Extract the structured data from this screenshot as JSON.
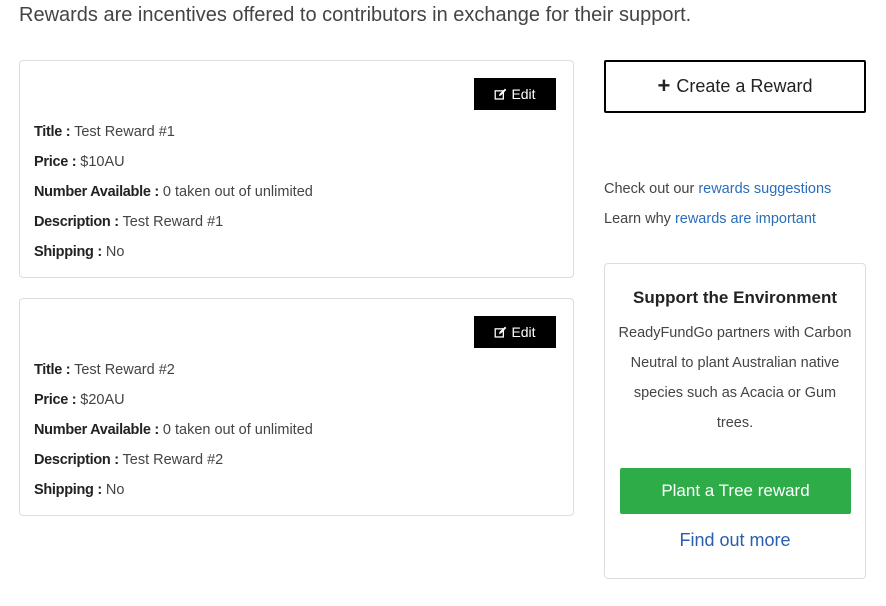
{
  "intro": "Rewards are incentives offered to contributors in exchange for their support.",
  "rewards": [
    {
      "edit_label": "Edit",
      "fields": [
        {
          "key": "Title :",
          "value": " Test Reward #1"
        },
        {
          "key": "Price :",
          "value": " $10AU"
        },
        {
          "key": "Number Available :",
          "value": " 0 taken out of unlimited"
        },
        {
          "key": "Description :",
          "value": " Test Reward #1"
        },
        {
          "key": "Shipping :",
          "value": " No"
        }
      ]
    },
    {
      "edit_label": "Edit",
      "fields": [
        {
          "key": "Title :",
          "value": " Test Reward #2"
        },
        {
          "key": "Price :",
          "value": " $20AU"
        },
        {
          "key": "Number Available :",
          "value": " 0 taken out of unlimited"
        },
        {
          "key": "Description :",
          "value": " Test Reward #2"
        },
        {
          "key": "Shipping :",
          "value": " No"
        }
      ]
    }
  ],
  "sidebar": {
    "create_label": "Create a Reward",
    "suggestions_prefix": "Check out our ",
    "suggestions_link": "rewards suggestions",
    "important_prefix": "Learn why ",
    "important_link": "rewards are important",
    "env": {
      "title": "Support the Environment",
      "body": "ReadyFundGo partners with Carbon Neutral to plant Australian native species such as Acacia or Gum trees.",
      "button_label": "Plant a Tree reward",
      "find_more": "Find out more"
    }
  },
  "colors": {
    "link": "#2a6ebb",
    "tree_button": "#2eac48",
    "edit_button": "#000000"
  },
  "icons": {
    "edit": "edit-icon",
    "create": "plus-icon"
  }
}
